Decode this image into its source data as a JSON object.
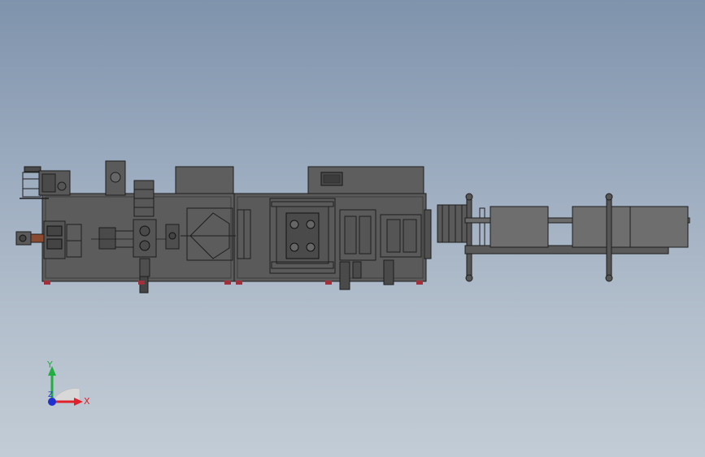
{
  "viewport": {
    "background_top": "#7f93ac",
    "background_bottom": "#c2ccd6"
  },
  "model": {
    "frame_color": "#5a5a5a",
    "line_color": "#1e1e1e",
    "accent_red": "#a0303a",
    "accent_orange": "#8a4a30",
    "roll_color": "#6e6e6e"
  },
  "triad": {
    "x_label": "X",
    "y_label": "Y",
    "z_label": "Z",
    "x_color": "#e0202a",
    "y_color": "#20b040",
    "z_color": "#2030d0"
  }
}
